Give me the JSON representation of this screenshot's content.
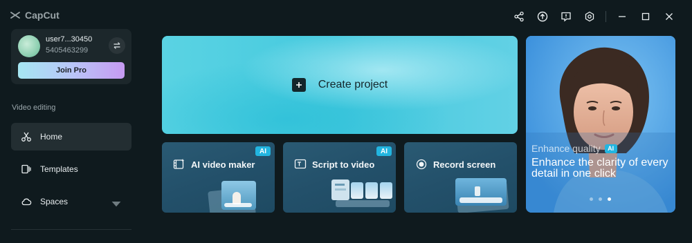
{
  "app": {
    "name": "CapCut"
  },
  "titlebar": {
    "icons": [
      "share-icon",
      "upload-icon",
      "feedback-icon",
      "settings-icon",
      "minimize-icon",
      "maximize-icon",
      "close-icon"
    ]
  },
  "account": {
    "username": "user7...30450",
    "user_id": "5405463299",
    "join_pro_label": "Join Pro"
  },
  "sidebar": {
    "section_label": "Video editing",
    "items": [
      {
        "label": "Home",
        "icon": "scissors-icon",
        "active": true
      },
      {
        "label": "Templates",
        "icon": "templates-icon",
        "active": false
      },
      {
        "label": "Spaces",
        "icon": "cloud-icon",
        "active": false
      }
    ]
  },
  "main": {
    "create_label": "Create project",
    "features": [
      {
        "label": "AI video maker",
        "icon": "ai-video-icon",
        "badge": "AI"
      },
      {
        "label": "Script to video",
        "icon": "script-icon",
        "badge": "AI"
      },
      {
        "label": "Record screen",
        "icon": "record-icon",
        "badge": ""
      }
    ]
  },
  "promo": {
    "subtitle": "Enhance quality",
    "badge": "AI",
    "headline": "Enhance the clarity of every detail in one click",
    "slide_count": 3,
    "active_slide": 3
  },
  "colors": {
    "background": "#0f1a1e",
    "accent": "#22b5e0",
    "create_card": "#45c9de",
    "feature_card": "#23506a",
    "promo_card": "#3f96e0"
  }
}
